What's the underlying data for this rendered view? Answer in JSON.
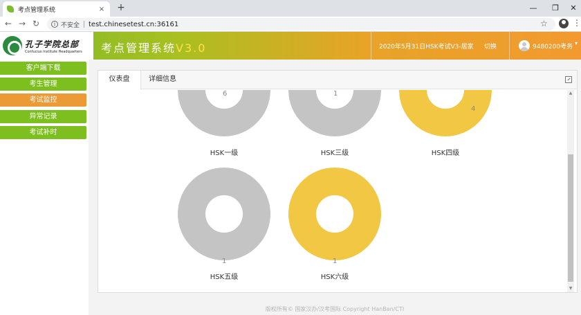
{
  "browser": {
    "tab_title": "考点管理系统",
    "close_glyph": "×",
    "new_tab_glyph": "+",
    "window_controls": {
      "minimize": "—",
      "maximize": "❐",
      "close": "✕"
    },
    "nav": {
      "back": "←",
      "forward": "→",
      "reload": "↻"
    },
    "secure_label": "不安全",
    "url": "test.chinesetest.cn:36161",
    "star_glyph": "☆",
    "menu_glyph": "⋮",
    "icons": [
      "info-icon",
      "star-icon",
      "profile-icon",
      "menu-icon"
    ]
  },
  "header": {
    "logo_cn": "孔子学院总部",
    "logo_en": "Confucius Institute Headquarters",
    "title": "考点管理系统",
    "version": "V3.0",
    "exam_info": "2020年5月31日HSK考试V3-居家",
    "switch_label": "切换",
    "user_label": "9480200考务",
    "caret": "▾",
    "colors": {
      "green": "#7ab92a",
      "orange": "#f29a2f",
      "version_yellow": "#ffe04a"
    }
  },
  "sidebar": {
    "items": [
      {
        "label": "客户端下载",
        "active": false
      },
      {
        "label": "考生管理",
        "active": false
      },
      {
        "label": "考试监控",
        "active": true
      },
      {
        "label": "异常记录",
        "active": false
      },
      {
        "label": "考试补时",
        "active": false
      }
    ],
    "colors": {
      "item": "#7cbf1f",
      "active": "#ec9a36"
    }
  },
  "panel": {
    "tabs": [
      {
        "label": "仪表盘",
        "active": true
      },
      {
        "label": "详细信息",
        "active": false
      }
    ],
    "scroll_up": "▲",
    "scroll_down": "▼"
  },
  "chart_data": {
    "type": "pie",
    "colors": {
      "gray": "#c4c4c4",
      "yellow": "#f2c744"
    },
    "charts": [
      {
        "label": "HSK一级",
        "value_label": "6",
        "yellow_fraction": 0
      },
      {
        "label": "HSK三级",
        "value_label": "1",
        "yellow_fraction": 0
      },
      {
        "label": "HSK四级",
        "value_label": "4",
        "yellow_fraction": 0.8
      },
      {
        "label": "HSK五级",
        "value_label": "1",
        "yellow_fraction": 0
      },
      {
        "label": "HSK六级",
        "value_label": "1",
        "yellow_fraction": 1
      }
    ]
  },
  "footer": {
    "text": "版权所有© 国家汉办/汉考国际 Copyright HanBan/CTI"
  }
}
